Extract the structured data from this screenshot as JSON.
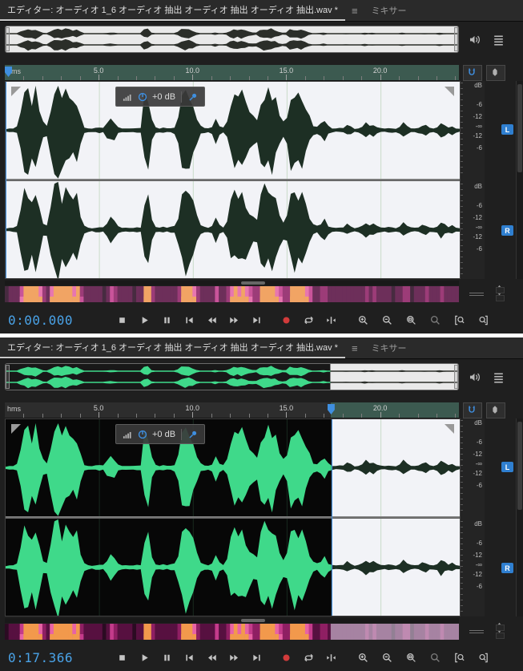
{
  "tabs": {
    "editor_label": "エディター: オーディオ 1_6 オーディオ 抽出 オーディオ 抽出 オーディオ 抽出.wav *",
    "mixer_label": "ミキサー",
    "panel_menu_glyph": "≡"
  },
  "timeline": {
    "unit": "hms",
    "duration_sec": 24.2,
    "tick_interval_sec": 5,
    "tick_labels": [
      "5.0",
      "10.0",
      "15.0",
      "20.0"
    ]
  },
  "db_scale": {
    "unit": "dB",
    "marks": [
      "-6",
      "-12",
      "-∞",
      "-12",
      "-6"
    ]
  },
  "channels": [
    "L",
    "R"
  ],
  "hud": {
    "gain_label": "+0 dB"
  },
  "panels": [
    {
      "id": "top",
      "time": "0:00.000",
      "playhead_sec": 0,
      "selection": {
        "start_sec": 0,
        "end_sec": 24.2,
        "full": true
      }
    },
    {
      "id": "bottom",
      "time": "0:17.366",
      "playhead_sec": 17.366,
      "selection": {
        "start_sec": 17.366,
        "end_sec": 24.2,
        "full": false
      }
    }
  ],
  "transport": {
    "buttons": [
      {
        "name": "stop-button",
        "icon": "stop"
      },
      {
        "name": "play-button",
        "icon": "play"
      },
      {
        "name": "pause-button",
        "icon": "pause"
      },
      {
        "name": "skip-to-start-button",
        "icon": "skip-start"
      },
      {
        "name": "rewind-button",
        "icon": "rewind"
      },
      {
        "name": "fast-forward-button",
        "icon": "fast-forward"
      },
      {
        "name": "skip-to-end-button",
        "icon": "skip-end"
      },
      {
        "name": "record-button",
        "icon": "record",
        "gap": true
      },
      {
        "name": "loop-playback-button",
        "icon": "loop"
      },
      {
        "name": "move-playhead-button",
        "icon": "move-cti"
      }
    ],
    "zoom_buttons": [
      {
        "name": "zoom-in-button",
        "icon": "zoom-in"
      },
      {
        "name": "zoom-out-button",
        "icon": "zoom-out"
      },
      {
        "name": "zoom-to-selection-button",
        "icon": "zoom-sel"
      },
      {
        "name": "zoom-full-button",
        "icon": "zoom-full",
        "dim": true
      },
      {
        "name": "zoom-selection-in-point-button",
        "icon": "zoom-bracket-left"
      },
      {
        "name": "zoom-selection-out-point-button",
        "icon": "zoom-bracket-right"
      }
    ]
  },
  "colors": {
    "accent_blue": "#3f8fe0",
    "record_red": "#d23b3b",
    "badge_blue": "#2f7fd0",
    "timecode_blue": "#4aa3e8",
    "waveform_green": "#3fd98a",
    "waveform_dark": "#1d2f24",
    "selection_bg": "#f2f3f7",
    "editor_bg": "#070707",
    "spectral_palette": [
      "#2b0b22",
      "#571040",
      "#8f1f63",
      "#c43b8b",
      "#e763a5",
      "#f2994c"
    ]
  },
  "waveform_envelope": [
    0.03,
    0.04,
    0.05,
    0.08,
    0.45,
    0.85,
    0.95,
    0.7,
    0.9,
    0.6,
    0.18,
    0.12,
    0.55,
    0.9,
    1.0,
    0.8,
    0.95,
    0.85,
    0.6,
    0.75,
    0.35,
    0.08,
    0.05,
    0.04,
    0.05,
    0.06,
    0.05,
    0.18,
    0.28,
    0.2,
    0.07,
    0.05,
    0.04,
    0.05,
    0.04,
    0.05,
    0.06,
    0.75,
    0.85,
    0.25,
    0.07,
    0.05,
    0.06,
    0.05,
    0.06,
    0.08,
    0.3,
    0.8,
    0.95,
    0.85,
    0.6,
    0.3,
    0.1,
    0.06,
    0.05,
    0.08,
    0.3,
    0.12,
    0.06,
    0.2,
    0.6,
    0.8,
    0.7,
    0.85,
    0.6,
    0.4,
    0.3,
    0.25,
    0.7,
    0.95,
    0.85,
    0.9,
    0.7,
    0.4,
    0.2,
    0.3,
    0.8,
    0.9,
    0.75,
    0.85,
    0.6,
    0.3,
    0.12,
    0.08,
    0.15,
    0.25,
    0.1,
    0.05,
    0.04,
    0.05,
    0.06,
    0.12,
    0.08,
    0.04,
    0.05,
    0.1,
    0.2,
    0.12,
    0.15,
    0.08,
    0.05,
    0.04,
    0.06,
    0.05,
    0.04,
    0.08,
    0.18,
    0.1,
    0.05,
    0.04,
    0.06,
    0.1,
    0.12,
    0.06,
    0.05,
    0.08,
    0.2,
    0.12,
    0.06,
    0.1,
    0.05,
    0.04
  ]
}
